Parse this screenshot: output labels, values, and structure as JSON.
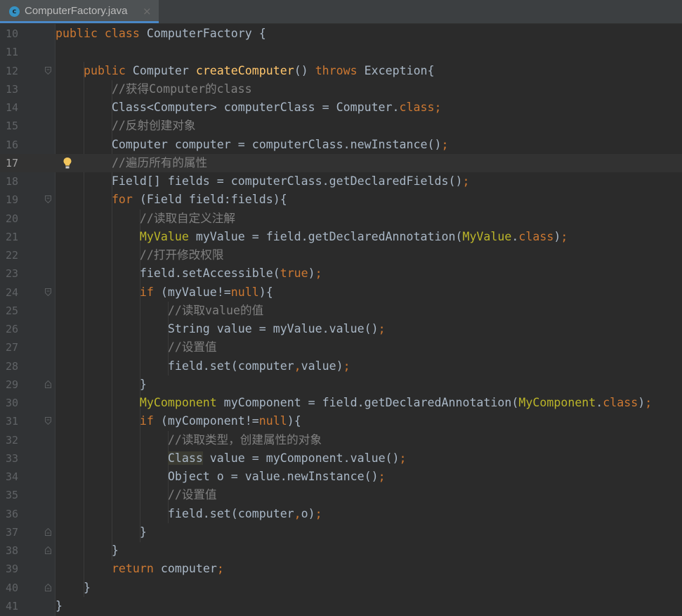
{
  "tab": {
    "title": "ComputerFactory.java",
    "icon": "java-class-icon",
    "icon_letter": "c",
    "close": "×"
  },
  "caret_line": 17,
  "colors": {
    "background": "#2b2b2b",
    "keyword": "#cc7832",
    "method_declaration": "#ffc66d",
    "comment": "#808080",
    "annotation": "#bbb529",
    "default_text": "#a9b7c6",
    "line_number": "#606366",
    "tab_underline": "#4a88c7"
  },
  "lines": [
    {
      "number": "10",
      "tokens": [
        {
          "t": "public class",
          "c": "kw"
        },
        {
          "t": " ComputerFactory {"
        }
      ]
    },
    {
      "number": "11",
      "tokens": []
    },
    {
      "number": "12",
      "fold": "open",
      "tokens": [
        {
          "t": "    "
        },
        {
          "t": "public",
          "c": "kw"
        },
        {
          "t": " Computer "
        },
        {
          "t": "createComputer",
          "c": "fn"
        },
        {
          "t": "() "
        },
        {
          "t": "throws",
          "c": "kw"
        },
        {
          "t": " Exception{"
        }
      ]
    },
    {
      "number": "13",
      "tokens": [
        {
          "t": "        "
        },
        {
          "t": "//获得Computer的class",
          "c": "cm"
        }
      ]
    },
    {
      "number": "14",
      "tokens": [
        {
          "t": "        Class<Computer> computerClass = Computer."
        },
        {
          "t": "class;",
          "c": "kw"
        }
      ]
    },
    {
      "number": "15",
      "tokens": [
        {
          "t": "        "
        },
        {
          "t": "//反射创建对象",
          "c": "cm"
        }
      ]
    },
    {
      "number": "16",
      "tokens": [
        {
          "t": "        Computer computer = computerClass.newInstance()"
        },
        {
          "t": ";",
          "c": "kw"
        }
      ]
    },
    {
      "number": "17",
      "bulb": true,
      "tokens": [
        {
          "t": "        "
        },
        {
          "t": "//遍历所有的属性",
          "c": "cm"
        }
      ]
    },
    {
      "number": "18",
      "tokens": [
        {
          "t": "        Field[] fields = computerClass.getDeclaredFields()"
        },
        {
          "t": ";",
          "c": "kw"
        }
      ]
    },
    {
      "number": "19",
      "fold": "open",
      "tokens": [
        {
          "t": "        "
        },
        {
          "t": "for",
          "c": "kw"
        },
        {
          "t": " (Field field:fields){"
        }
      ]
    },
    {
      "number": "20",
      "tokens": [
        {
          "t": "            "
        },
        {
          "t": "//读取自定义注解",
          "c": "cm"
        }
      ]
    },
    {
      "number": "21",
      "tokens": [
        {
          "t": "            "
        },
        {
          "t": "MyValue",
          "c": "an"
        },
        {
          "t": " myValue = field.getDeclaredAnnotation("
        },
        {
          "t": "MyValue",
          "c": "an"
        },
        {
          "t": "."
        },
        {
          "t": "class",
          "c": "kw"
        },
        {
          "t": ")"
        },
        {
          "t": ";",
          "c": "kw"
        }
      ]
    },
    {
      "number": "22",
      "tokens": [
        {
          "t": "            "
        },
        {
          "t": "//打开修改权限",
          "c": "cm"
        }
      ]
    },
    {
      "number": "23",
      "tokens": [
        {
          "t": "            field.setAccessible("
        },
        {
          "t": "true",
          "c": "kw"
        },
        {
          "t": ")"
        },
        {
          "t": ";",
          "c": "kw"
        }
      ]
    },
    {
      "number": "24",
      "fold": "open",
      "tokens": [
        {
          "t": "            "
        },
        {
          "t": "if",
          "c": "kw"
        },
        {
          "t": " (myValue!="
        },
        {
          "t": "null",
          "c": "kw"
        },
        {
          "t": "){"
        }
      ]
    },
    {
      "number": "25",
      "tokens": [
        {
          "t": "                "
        },
        {
          "t": "//读取value的值",
          "c": "cm"
        }
      ]
    },
    {
      "number": "26",
      "tokens": [
        {
          "t": "                String value = myValue.value()"
        },
        {
          "t": ";",
          "c": "kw"
        }
      ]
    },
    {
      "number": "27",
      "tokens": [
        {
          "t": "                "
        },
        {
          "t": "//设置值",
          "c": "cm"
        }
      ]
    },
    {
      "number": "28",
      "tokens": [
        {
          "t": "                field.set(computer"
        },
        {
          "t": ",",
          "c": "kw"
        },
        {
          "t": "value)"
        },
        {
          "t": ";",
          "c": "kw"
        }
      ]
    },
    {
      "number": "29",
      "fold": "close",
      "tokens": [
        {
          "t": "            }"
        }
      ]
    },
    {
      "number": "30",
      "tokens": [
        {
          "t": "            "
        },
        {
          "t": "MyComponent",
          "c": "an"
        },
        {
          "t": " myComponent = field.getDeclaredAnnotation("
        },
        {
          "t": "MyComponent",
          "c": "an"
        },
        {
          "t": "."
        },
        {
          "t": "class",
          "c": "kw"
        },
        {
          "t": ")"
        },
        {
          "t": ";",
          "c": "kw"
        }
      ]
    },
    {
      "number": "31",
      "fold": "open",
      "tokens": [
        {
          "t": "            "
        },
        {
          "t": "if",
          "c": "kw"
        },
        {
          "t": " (myComponent!="
        },
        {
          "t": "null",
          "c": "kw"
        },
        {
          "t": "){"
        }
      ]
    },
    {
      "number": "32",
      "tokens": [
        {
          "t": "                "
        },
        {
          "t": "//读取类型，创建属性的对象",
          "c": "cm"
        }
      ]
    },
    {
      "number": "33",
      "tokens": [
        {
          "t": "                "
        },
        {
          "t": "Class",
          "c": "hl"
        },
        {
          "t": " value = myComponent.value()"
        },
        {
          "t": ";",
          "c": "kw"
        }
      ]
    },
    {
      "number": "34",
      "tokens": [
        {
          "t": "                Object o = value.newInstance()"
        },
        {
          "t": ";",
          "c": "kw"
        }
      ]
    },
    {
      "number": "35",
      "tokens": [
        {
          "t": "                "
        },
        {
          "t": "//设置值",
          "c": "cm"
        }
      ]
    },
    {
      "number": "36",
      "tokens": [
        {
          "t": "                field.set(computer"
        },
        {
          "t": ",",
          "c": "kw"
        },
        {
          "t": "o)"
        },
        {
          "t": ";",
          "c": "kw"
        }
      ]
    },
    {
      "number": "37",
      "fold": "close",
      "tokens": [
        {
          "t": "            }"
        }
      ]
    },
    {
      "number": "38",
      "fold": "close",
      "tokens": [
        {
          "t": "        }"
        }
      ]
    },
    {
      "number": "39",
      "tokens": [
        {
          "t": "        "
        },
        {
          "t": "return",
          "c": "kw"
        },
        {
          "t": " computer"
        },
        {
          "t": ";",
          "c": "kw"
        }
      ]
    },
    {
      "number": "40",
      "fold": "close",
      "tokens": [
        {
          "t": "    }"
        }
      ]
    },
    {
      "number": "41",
      "tokens": [
        {
          "t": "}"
        }
      ]
    }
  ]
}
